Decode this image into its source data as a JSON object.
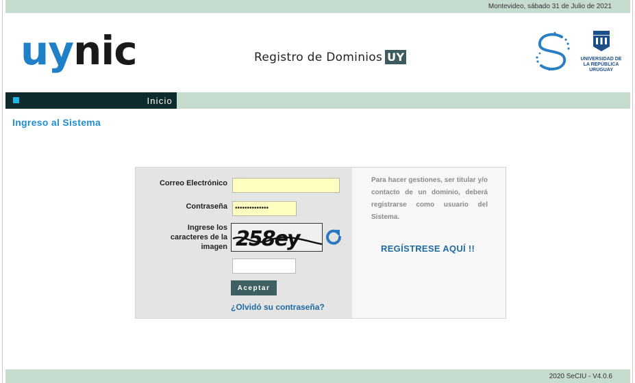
{
  "header": {
    "date": "Montevideo, sábado 31 de Julio de 2021",
    "logo_part1": "uy",
    "logo_part2": "nic",
    "title": "Registro de Dominios",
    "title_badge": "UY",
    "udelar_text": "UNIVERSIDAD DE LA REPÚBLICA URUGUAY"
  },
  "nav": {
    "items": [
      {
        "label": "Inicio"
      }
    ]
  },
  "page": {
    "title": "Ingreso al Sistema"
  },
  "login": {
    "email_label": "Correo Electrónico",
    "email_value": "",
    "password_label": "Contraseña",
    "password_value": "••••••••••••••",
    "captcha_label": "Ingrese los caracteres de la imagen",
    "captcha_image_text": "258ey",
    "captcha_value": "",
    "accept_label": "Aceptar",
    "forgot_label": "¿Olvidó su contraseña?"
  },
  "info": {
    "text": "Para hacer gestiones, ser titular y/o contacto de un dominio, deberá registrarse como usuario del Sistema.",
    "register_label": "REGÍSTRESE AQUÍ !!"
  },
  "footer": {
    "version": "2020 SeCIU - V4.0.6"
  },
  "colors": {
    "accent_green": "#c5dccf",
    "nav_dark": "#0e2a2d",
    "link_blue": "#1e6aa3",
    "title_blue": "#1f8dd0",
    "logo_blue": "#1f7fc7"
  }
}
